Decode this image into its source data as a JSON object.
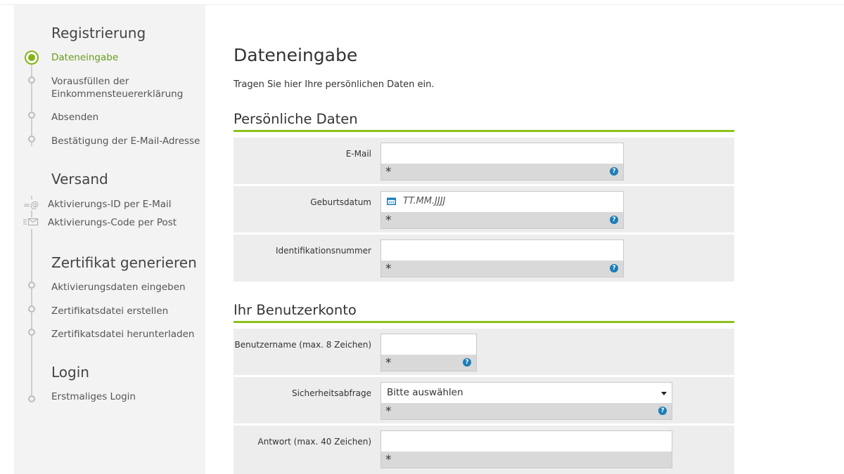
{
  "sidebar": {
    "registration": {
      "title": "Registrierung",
      "steps": [
        {
          "label": "Dateneingabe",
          "state": "active"
        },
        {
          "label": "Vorausfüllen der\nEinkommensteuererklärung",
          "state": "pending"
        },
        {
          "label": "Absenden",
          "state": "pending"
        },
        {
          "label": "Bestätigung der E-Mail-Adresse",
          "state": "pending"
        }
      ]
    },
    "shipping": {
      "title": "Versand",
      "options": [
        {
          "label": "Aktivierungs-ID per E-Mail",
          "icon": "email-at-icon"
        },
        {
          "label": "Aktivierungs-Code per Post",
          "icon": "mail-letter-icon"
        }
      ]
    },
    "certificate": {
      "title": "Zertifikat generieren",
      "steps": [
        {
          "label": "Aktivierungsdaten eingeben"
        },
        {
          "label": "Zertifikatsdatei erstellen"
        },
        {
          "label": "Zertifikatsdatei herunterladen"
        }
      ]
    },
    "login": {
      "title": "Login",
      "steps": [
        {
          "label": "Erstmaliges Login"
        }
      ]
    }
  },
  "main": {
    "title": "Dateneingabe",
    "intro": "Tragen Sie hier Ihre persönlichen Daten ein.",
    "personal": {
      "heading": "Persönliche Daten",
      "email_label": "E-Mail",
      "birthdate_label": "Geburtsdatum",
      "birthdate_placeholder": "TT.MM.JJJJ",
      "id_label": "Identifikationsnummer"
    },
    "account": {
      "heading": "Ihr Benutzerkonto",
      "username_label": "Benutzername (max. 8 Zeichen)",
      "security_label": "Sicherheitsabfrage",
      "security_selected": "Bitte auswählen",
      "answer_label": "Antwort (max. 40 Zeichen)"
    },
    "required_marker": "*",
    "help_glyph": "?"
  },
  "colors": {
    "accent_green": "#8cc21a",
    "active_text": "#6a9a1f",
    "help_blue": "#1d7db8",
    "sidebar_bg": "#f3f3f3",
    "row_bg": "#ededed"
  }
}
